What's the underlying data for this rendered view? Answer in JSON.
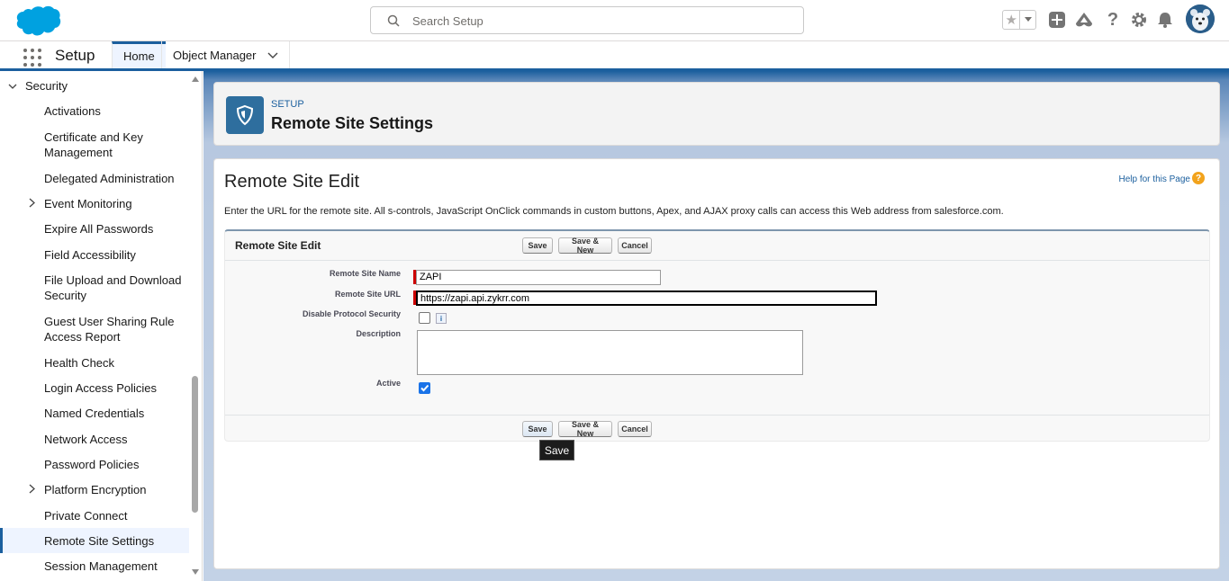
{
  "header": {
    "search_placeholder": "Search Setup",
    "icons": [
      "salesforce-logo",
      "search-icon",
      "star-icon",
      "chevron-down-icon",
      "plus-icon",
      "trailhead-icon",
      "help-icon",
      "gear-icon",
      "bell-icon",
      "avatar"
    ]
  },
  "context_bar": {
    "app_name": "Setup",
    "tabs": [
      {
        "label": "Home",
        "active": true
      },
      {
        "label": "Object Manager",
        "active": false
      }
    ]
  },
  "sidebar": {
    "section_label": "Security",
    "items": [
      {
        "label": "Activations"
      },
      {
        "label": "Certificate and Key Management"
      },
      {
        "label": "Delegated Administration"
      },
      {
        "label": "Event Monitoring"
      },
      {
        "label": "Expire All Passwords"
      },
      {
        "label": "Field Accessibility"
      },
      {
        "label": "File Upload and Download Security"
      },
      {
        "label": "Guest User Sharing Rule Access Report"
      },
      {
        "label": "Health Check"
      },
      {
        "label": "Login Access Policies"
      },
      {
        "label": "Named Credentials"
      },
      {
        "label": "Network Access"
      },
      {
        "label": "Password Policies"
      },
      {
        "label": "Platform Encryption"
      },
      {
        "label": "Private Connect"
      },
      {
        "label": "Remote Site Settings"
      },
      {
        "label": "Session Management"
      }
    ]
  },
  "page_header": {
    "eyebrow": "SETUP",
    "title": "Remote Site Settings"
  },
  "edit": {
    "title": "Remote Site Edit",
    "help_link": "Help for this Page",
    "intro": "Enter the URL for the remote site. All s-controls, JavaScript OnClick commands in custom buttons, Apex, and AJAX proxy calls can access this Web address from salesforce.com.",
    "block_title": "Remote Site Edit",
    "buttons": {
      "save": "Save",
      "save_new": "Save & New",
      "cancel": "Cancel"
    },
    "fields": {
      "name_label": "Remote Site Name",
      "name_value": "ZAPI",
      "url_label": "Remote Site URL",
      "url_value": "https://zapi.api.zykrr.com",
      "disable_label": "Disable Protocol Security",
      "disable_checked": false,
      "description_label": "Description",
      "description_value": "",
      "active_label": "Active",
      "active_checked": true
    },
    "tooltip": "Save"
  }
}
